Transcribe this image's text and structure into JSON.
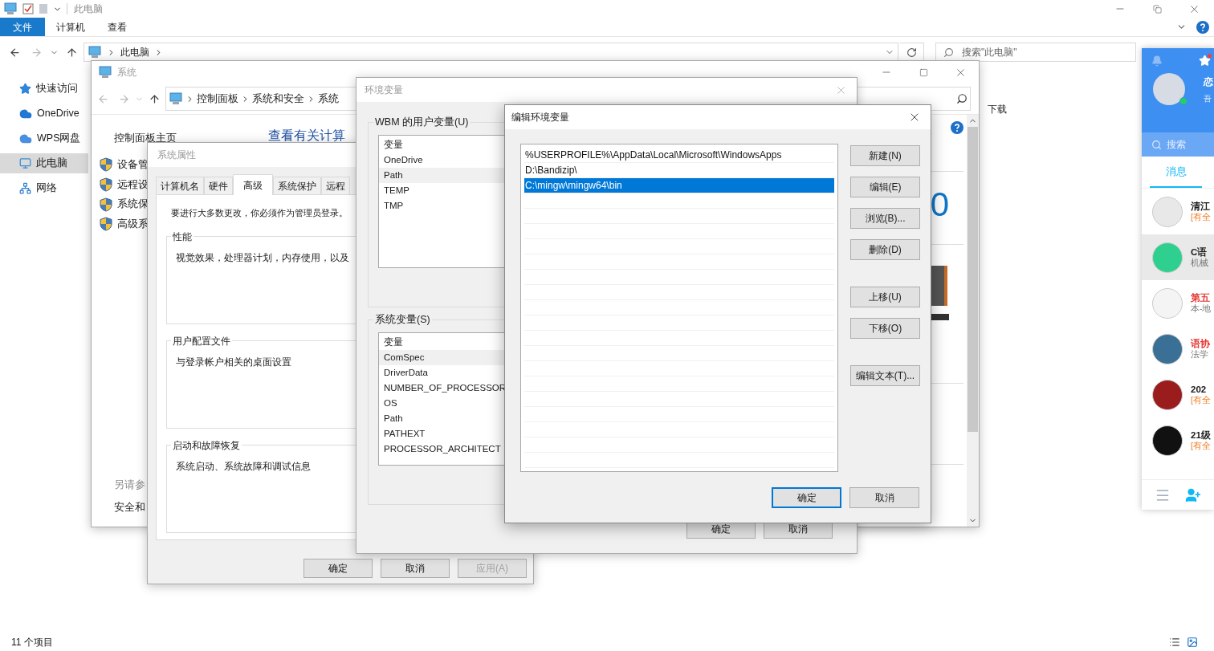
{
  "explorer": {
    "title": "此电脑",
    "ribbon_tabs": [
      {
        "label": "文件",
        "selected": true
      },
      {
        "label": "计算机",
        "selected": false
      },
      {
        "label": "查看",
        "selected": false
      }
    ],
    "address": [
      "此电脑"
    ],
    "search": {
      "placeholder": "搜索\"此电脑\""
    },
    "nav_items": [
      {
        "label": "快速访问",
        "selected": false
      },
      {
        "label": "OneDrive",
        "selected": false
      },
      {
        "label": "WPS网盘",
        "selected": false
      },
      {
        "label": "此电脑",
        "selected": true
      },
      {
        "label": "网络",
        "selected": false
      }
    ],
    "content_items": [
      "下载"
    ],
    "status_bar": "11 个项目"
  },
  "system_window": {
    "title": "系统",
    "breadcrumb": [
      "控制面板",
      "系统和安全",
      "系统"
    ],
    "home_link": "控制面板主页",
    "admin_links": [
      "设备管",
      "远程设",
      "系统保",
      "高级系"
    ],
    "see_also": {
      "heading": "另请参",
      "links": [
        "安全和"
      ]
    },
    "heading": "查看有关计算",
    "number": "0"
  },
  "system_properties": {
    "title": "系统属性",
    "tabs": [
      {
        "label": "计算机名",
        "selected": false
      },
      {
        "label": "硬件",
        "selected": false
      },
      {
        "label": "高级",
        "selected": true
      },
      {
        "label": "系统保护",
        "selected": false
      },
      {
        "label": "远程",
        "selected": false
      }
    ],
    "notice": "要进行大多数更改，你必须作为管理员登录。",
    "groups": [
      {
        "title": "性能",
        "text": "视觉效果，处理器计划，内存使用，以及"
      },
      {
        "title": "用户配置文件",
        "text": "与登录帐户相关的桌面设置"
      },
      {
        "title": "启动和故障恢复",
        "text": "系统启动、系统故障和调试信息"
      }
    ],
    "buttons": [
      {
        "label": "确定",
        "disabled": false
      },
      {
        "label": "取消",
        "disabled": false
      },
      {
        "label": "应用(A)",
        "disabled": true
      }
    ]
  },
  "environment_variables": {
    "title": "环境变量",
    "user_group": {
      "title": "WBM 的用户变量(U)",
      "column": "变量",
      "rows": [
        {
          "name": "OneDrive",
          "selected": false
        },
        {
          "name": "Path",
          "selected": true
        },
        {
          "name": "TEMP",
          "selected": false
        },
        {
          "name": "TMP",
          "selected": false
        }
      ]
    },
    "system_group": {
      "title": "系统变量(S)",
      "column": "变量",
      "rows": [
        {
          "name": "ComSpec",
          "selected": true
        },
        {
          "name": "DriverData",
          "selected": false
        },
        {
          "name": "NUMBER_OF_PROCESSOR",
          "selected": false
        },
        {
          "name": "OS",
          "selected": false
        },
        {
          "name": "Path",
          "selected": false
        },
        {
          "name": "PATHEXT",
          "selected": false
        },
        {
          "name": "PROCESSOR_ARCHITECT",
          "selected": false
        }
      ]
    },
    "buttons": [
      "确定",
      "取消"
    ]
  },
  "edit_env": {
    "title": "编辑环境变量",
    "entries": [
      {
        "value": "%USERPROFILE%\\AppData\\Local\\Microsoft\\WindowsApps",
        "selected": false
      },
      {
        "value": "D:\\Bandizip\\",
        "selected": false
      },
      {
        "value": "C:\\mingw\\mingw64\\bin",
        "selected": true
      }
    ],
    "side_button_groups": [
      [
        "新建(N)",
        "编辑(E)",
        "浏览(B)...",
        "删除(D)"
      ],
      [
        "上移(U)",
        "下移(O)"
      ],
      [
        "编辑文本(T)..."
      ]
    ],
    "buttons": [
      {
        "label": "确定",
        "default": true
      },
      {
        "label": "取消",
        "default": false
      }
    ]
  },
  "qq": {
    "profile": {
      "name": "恋",
      "signature": "吾"
    },
    "search": {
      "placeholder": "搜索"
    },
    "tabs": [
      {
        "label": "消息",
        "selected": true
      }
    ],
    "chats": [
      {
        "name": "清江",
        "preview": "[有全",
        "color": "#1a1a1a",
        "mention": true,
        "selected": false
      },
      {
        "name": "C语",
        "preview": "机械",
        "color": "#1a1a1a",
        "mention": false,
        "selected": true
      },
      {
        "name": "第五",
        "preview": "本-地",
        "color": "#e5322d",
        "mention": false,
        "selected": false
      },
      {
        "name": "语协",
        "preview": "法学",
        "color": "#e5322d",
        "mention": false,
        "selected": false
      },
      {
        "name": "202",
        "preview": "[有全",
        "color": "#1a1a1a",
        "mention": true,
        "selected": false
      },
      {
        "name": "21级",
        "preview": "[有全",
        "color": "#1a1a1a",
        "mention": true,
        "selected": false
      }
    ]
  }
}
